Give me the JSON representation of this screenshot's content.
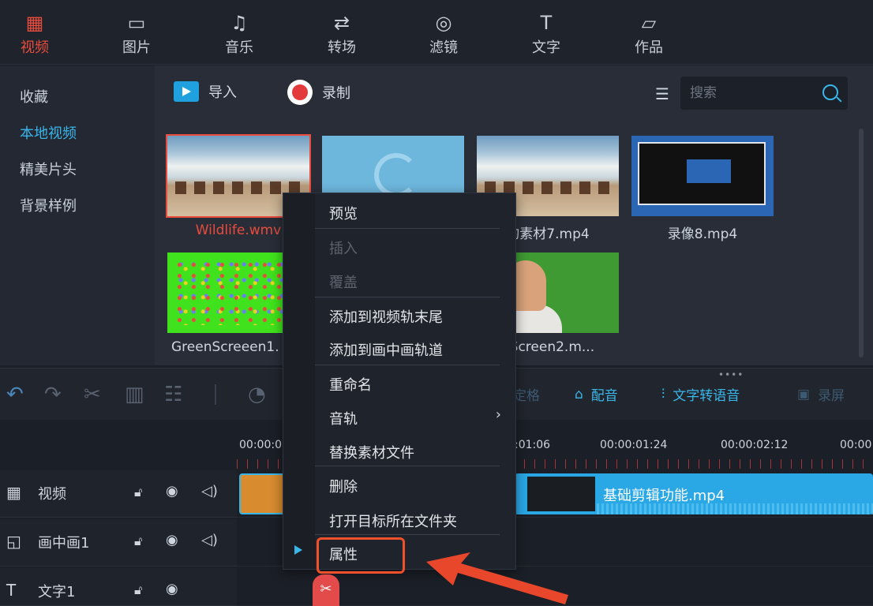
{
  "nav": {
    "items": [
      {
        "label": "视频",
        "icon": "film-icon"
      },
      {
        "label": "图片",
        "icon": "image-icon"
      },
      {
        "label": "音乐",
        "icon": "music-icon"
      },
      {
        "label": "转场",
        "icon": "transition-icon"
      },
      {
        "label": "滤镜",
        "icon": "filter-icon"
      },
      {
        "label": "文字",
        "icon": "text-icon"
      },
      {
        "label": "作品",
        "icon": "folder-icon"
      }
    ],
    "active": "视频"
  },
  "categories": [
    "收藏",
    "本地视频",
    "精美片头",
    "背景样例"
  ],
  "active_category": "本地视频",
  "library": {
    "import_label": "导入",
    "record_label": "录制",
    "search_placeholder": "搜索",
    "items": [
      {
        "caption": "Wildlife.wmv",
        "selected": true
      },
      {
        "caption": ""
      },
      {
        "caption": "的素材7.mp4"
      },
      {
        "caption": "录像8.mp4"
      },
      {
        "caption": "GreenScreeen1."
      },
      {
        "caption": ""
      },
      {
        "caption": "nScreen2.m..."
      }
    ]
  },
  "editbar": {
    "split_label": "定格",
    "dub_label": "配音",
    "tts_label": "文字转语音",
    "record_screen_label": "录屏"
  },
  "timeline": {
    "timecodes": [
      "00:00:0",
      ":01:06",
      "00:00:01:24",
      "00:00:02:12",
      "00:00"
    ],
    "tracks": [
      {
        "name": "视频",
        "icon": "film-icon"
      },
      {
        "name": "画中画1",
        "icon": "pip-icon"
      },
      {
        "name": "文字1",
        "icon": "text-icon"
      }
    ],
    "clip_name": "基础剪辑功能.mp4"
  },
  "context_menu": {
    "items": [
      {
        "label": "预览",
        "disabled": false
      },
      {
        "label": "插入",
        "disabled": true
      },
      {
        "label": "覆盖",
        "disabled": true
      },
      {
        "label": "添加到视频轨末尾",
        "disabled": false
      },
      {
        "label": "添加到画中画轨道",
        "disabled": false
      },
      {
        "label": "重命名",
        "disabled": false
      },
      {
        "label": "音轨",
        "disabled": false,
        "submenu": true
      },
      {
        "label": "替换素材文件",
        "disabled": false
      },
      {
        "label": "删除",
        "disabled": false
      },
      {
        "label": "打开目标所在文件夹",
        "disabled": false
      },
      {
        "label": "属性",
        "disabled": false,
        "highlighted": true
      }
    ]
  },
  "colors": {
    "accent": "#39b6e9",
    "active_nav": "#e84c3d",
    "highlight_box": "#f0502a"
  }
}
